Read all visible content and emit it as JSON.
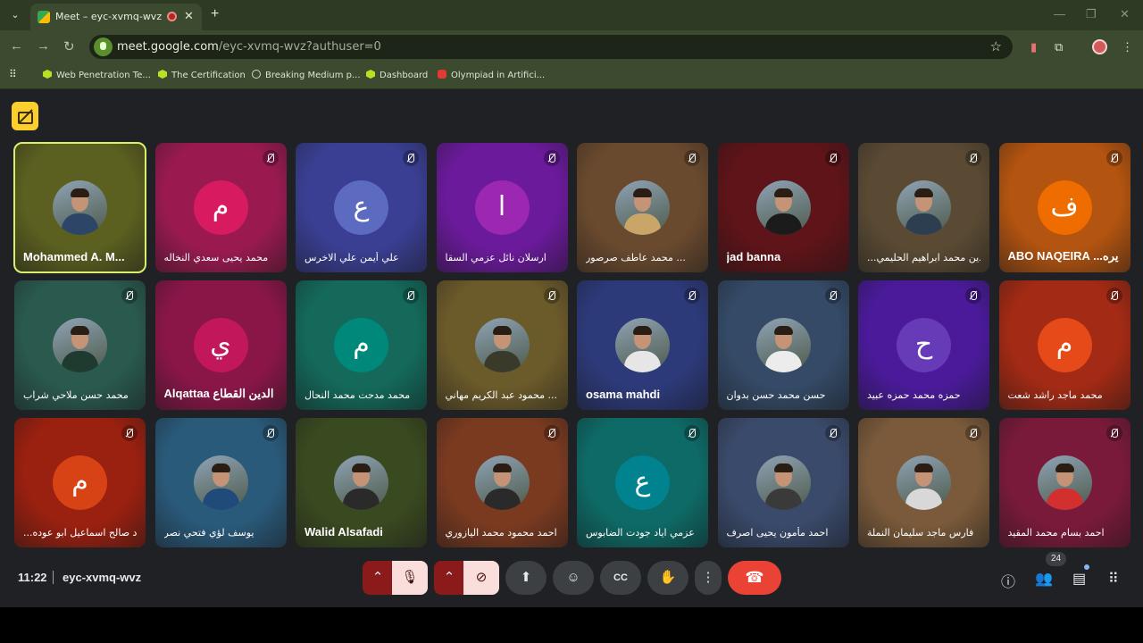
{
  "browser": {
    "tab_title": "Meet – eyc-xvmq-wvz",
    "url_host": "meet.google.com",
    "url_path": "/eyc-xvmq-wvz?authuser=0",
    "bookmarks": [
      {
        "label": "Web Penetration Te...",
        "icon": "hex-icon"
      },
      {
        "label": "The Certification",
        "icon": "hex-icon"
      },
      {
        "label": "Breaking Medium p...",
        "icon": "globe-icon"
      },
      {
        "label": "Dashboard",
        "icon": "hex-icon"
      },
      {
        "label": "Olympiad in Artifici...",
        "icon": "youtube-icon"
      }
    ]
  },
  "meeting": {
    "time": "11:22",
    "code": "eyc-xvmq-wvz",
    "participant_count": "24",
    "tiles": [
      {
        "name": "Mohammed A. M...",
        "kind": "photo",
        "bg": "#5b5f1f",
        "body": "#2d4566",
        "speaking": true,
        "muted": false
      },
      {
        "name": "محمد يحيى سعدي النخاله",
        "kind": "letter",
        "letter": "م",
        "bg": "#9a1a50",
        "circle": "#d81b60",
        "muted": true
      },
      {
        "name": "علي أيمن علي الاخرس",
        "kind": "letter",
        "letter": "ع",
        "bg": "#3a3f93",
        "circle": "#5c6bc0",
        "muted": true
      },
      {
        "name": "ارسلان نائل عزمي السقا",
        "kind": "letter",
        "letter": "ا",
        "bg": "#6a1a9a",
        "circle": "#9c27b0",
        "muted": true
      },
      {
        "name": "محمد عاطف صرصور ...",
        "kind": "photo",
        "bg": "#6a4a2e",
        "body": "#c9a567",
        "muted": true
      },
      {
        "name": "jad banna",
        "kind": "photo",
        "bg": "#5e1418",
        "body": "#1b1b1b",
        "muted": true
      },
      {
        "name": "...دين محمد ابراهيم الحليمي",
        "kind": "photo",
        "bg": "#5a4a33",
        "body": "#2c3e50",
        "muted": true
      },
      {
        "name": "ABO NAQEIRA ...يره",
        "kind": "letter",
        "letter": "ف",
        "bg": "#b35410",
        "circle": "#ef6c00",
        "muted": true
      },
      {
        "name": "محمد حسن ملاحي شراب",
        "kind": "photo",
        "bg": "#2a5a4e",
        "body": "#1f3a2e",
        "muted": true
      },
      {
        "name": "Alqattaa الدين القطاع ...",
        "kind": "letter",
        "letter": "ي",
        "bg": "#8a1648",
        "circle": "#c2185b",
        "muted": false
      },
      {
        "name": "محمد مدحت محمد النحال",
        "kind": "letter",
        "letter": "م",
        "bg": "#14695a",
        "circle": "#00897b",
        "muted": true
      },
      {
        "name": "محمود عبد الكريم مهاني ...",
        "kind": "photo",
        "bg": "#6b5a2a",
        "body": "#3a3a2a",
        "muted": true
      },
      {
        "name": "osama mahdi",
        "kind": "photo",
        "bg": "#2d3a7a",
        "body": "#e6e6e6",
        "muted": true
      },
      {
        "name": "حسن محمد حسن بدوان",
        "kind": "photo",
        "bg": "#344a66",
        "body": "#ececec",
        "muted": true
      },
      {
        "name": "حمزه محمد حمزه عبيد",
        "kind": "letter",
        "letter": "ح",
        "bg": "#4a1a9a",
        "circle": "#673ab7",
        "muted": true
      },
      {
        "name": "محمد ماجد راشد شعت",
        "kind": "letter",
        "letter": "م",
        "bg": "#a32a14",
        "circle": "#e64a19",
        "muted": true
      },
      {
        "name": "...د صالح اسماعيل ابو عوده",
        "kind": "letter",
        "letter": "م",
        "bg": "#9a2010",
        "circle": "#d84315",
        "muted": true
      },
      {
        "name": "يوسف لؤي فتحي نصر",
        "kind": "photo",
        "bg": "#2a5a7a",
        "body": "#1f4a7a",
        "muted": true
      },
      {
        "name": "Walid Alsafadi",
        "kind": "photo",
        "bg": "#3a4a20",
        "body": "#2a2a2a",
        "muted": false
      },
      {
        "name": "احمد محمود محمد اليازوري",
        "kind": "photo",
        "bg": "#7a3a20",
        "body": "#2a2a2a",
        "muted": true
      },
      {
        "name": "عزمي اياد جودت الضابوس",
        "kind": "letter",
        "letter": "ع",
        "bg": "#0e6a66",
        "circle": "#00838f",
        "muted": true
      },
      {
        "name": "احمد مأمون يحيى اصرف",
        "kind": "photo",
        "bg": "#3a4a6a",
        "body": "#3a3a3a",
        "muted": true
      },
      {
        "name": "فارس ماجد سليمان النملة",
        "kind": "photo",
        "bg": "#7a5a3a",
        "body": "#d8d8d8",
        "muted": true
      },
      {
        "name": "احمد بسام محمد المقيد",
        "kind": "photo",
        "bg": "#7a1a3a",
        "body": "#d32f2f",
        "muted": true
      }
    ]
  },
  "controls": [
    {
      "name": "mic-options-chevron",
      "glyph": "⌃"
    },
    {
      "name": "microphone-off-button",
      "glyph": "🎙"
    },
    {
      "name": "camera-options-chevron",
      "glyph": "⌃"
    },
    {
      "name": "camera-off-button",
      "glyph": "⊘"
    },
    {
      "name": "present-screen-button",
      "glyph": "⬆"
    },
    {
      "name": "emoji-reactions-button",
      "glyph": "☺"
    },
    {
      "name": "captions-button",
      "glyph": "CC"
    },
    {
      "name": "raise-hand-button",
      "glyph": "✋"
    },
    {
      "name": "more-options-button",
      "glyph": "⋮"
    },
    {
      "name": "leave-call-button",
      "glyph": "☎"
    }
  ]
}
